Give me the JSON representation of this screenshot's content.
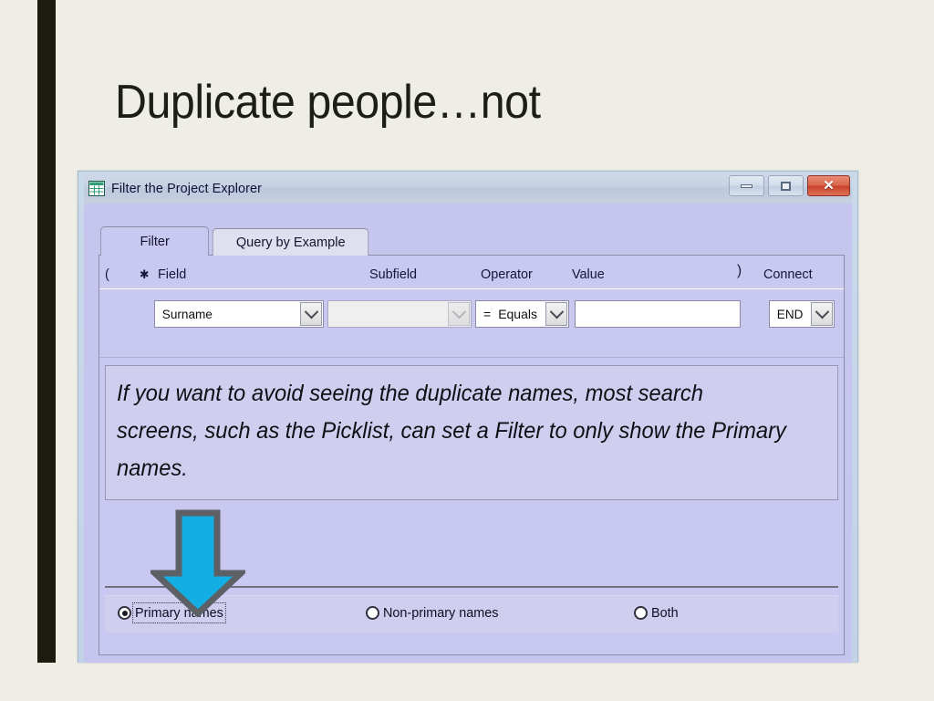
{
  "slide": {
    "title": "Duplicate people…not",
    "background_color": "#efeee6",
    "accent_bar_color": "#1b1b10"
  },
  "dialog": {
    "titlebar": {
      "icon": "grid-table-icon",
      "title": "Filter the Project Explorer",
      "buttons": {
        "minimize_label": "–",
        "maximize_label": "□",
        "close_label": "✕"
      }
    },
    "tabs": [
      {
        "label": "Filter",
        "active": true
      },
      {
        "label": "Query by Example",
        "active": false
      }
    ],
    "criteria_headers": {
      "open_paren": "(",
      "required": "✱",
      "field": "Field",
      "subfield": "Subfield",
      "operator": "Operator",
      "value": "Value",
      "close_paren": ")",
      "connect": "Connect"
    },
    "criteria_row": {
      "field_value": "Surname",
      "subfield_value": "",
      "operator_symbol": "=",
      "operator_label": "Equals",
      "value_text": "",
      "connect_value": "END"
    },
    "callout": {
      "text": "If you want to avoid seeing the duplicate names, most search screens, such as the Picklist, can set a Filter to only show the Primary names."
    },
    "arrow": {
      "name": "down-arrow-annotation",
      "fill_color": "#12aee4",
      "stroke_color": "#5d6166"
    },
    "radio_group": [
      {
        "label": "Primary names",
        "checked": true,
        "focused": true
      },
      {
        "label": "Non-primary names",
        "checked": false,
        "focused": false
      },
      {
        "label": "Both",
        "checked": false,
        "focused": false
      }
    ]
  }
}
